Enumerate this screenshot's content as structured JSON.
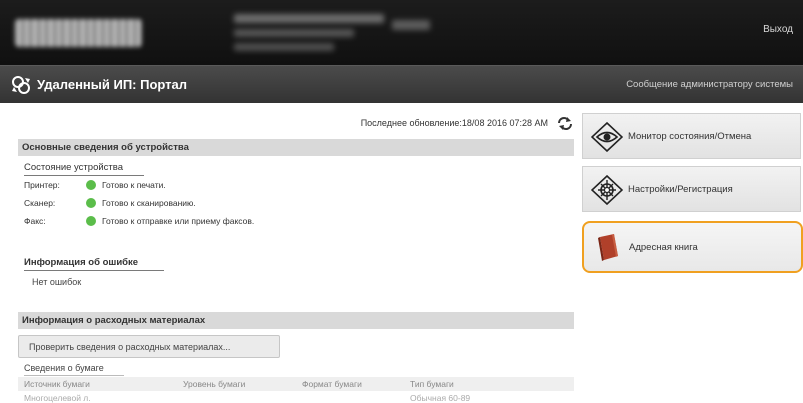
{
  "header": {
    "logout_label": "Выход"
  },
  "titlebar": {
    "title": "Удаленный ИП: Портал",
    "admin_message": "Сообщение администратору системы"
  },
  "main": {
    "last_update": "Последнее обновление:18/08 2016 07:28 AM",
    "device_section": {
      "heading": "Основные сведения об устройства",
      "status_title": "Состояние устройства",
      "rows": [
        {
          "label": "Принтер:",
          "status": "Готово к печати."
        },
        {
          "label": "Сканер:",
          "status": "Готово к сканированию."
        },
        {
          "label": "Факс:",
          "status": "Готово к отправке или приему факсов."
        }
      ],
      "status_color": "#5bbd4a",
      "error_title": "Информация об ошибке",
      "error_text": "Нет ошибок"
    },
    "supplies_section": {
      "heading": "Информация о расходных материалах",
      "check_button": "Проверить сведения о расходных материалах...",
      "paper_title": "Сведения о бумаге",
      "columns": [
        "Источник бумаги",
        "Уровень бумаги",
        "Формат бумаги",
        "Тип бумаги"
      ],
      "first_row": [
        "Многоцелевой л.",
        "",
        "",
        "Обычная 60-89"
      ]
    }
  },
  "side": {
    "buttons": [
      {
        "label": "Монитор состояния/Отмена",
        "icon": "eye-icon"
      },
      {
        "label": "Настройки/Регистрация",
        "icon": "settings-gear-icon"
      },
      {
        "label": "Адресная книга",
        "icon": "address-book-icon"
      }
    ],
    "highlight_color": "#f0a020"
  }
}
